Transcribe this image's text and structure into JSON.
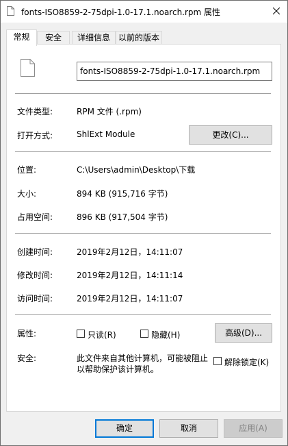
{
  "window": {
    "title": "fonts-ISO8859-2-75dpi-1.0-17.1.noarch.rpm 属性"
  },
  "tabs": [
    {
      "label": "常规",
      "active": true
    },
    {
      "label": "安全",
      "active": false
    },
    {
      "label": "详细信息",
      "active": false
    },
    {
      "label": "以前的版本",
      "active": false
    }
  ],
  "general": {
    "filename": "fonts-ISO8859-2-75dpi-1.0-17.1.noarch.rpm",
    "file_type_label": "文件类型:",
    "file_type_value": "RPM 文件 (.rpm)",
    "opens_with_label": "打开方式:",
    "opens_with_value": "ShlExt Module",
    "change_button": "更改(C)...",
    "location_label": "位置:",
    "location_value": "C:\\Users\\admin\\Desktop\\下载",
    "size_label": "大小:",
    "size_value": "894 KB (915,716 字节)",
    "size_on_disk_label": "占用空间:",
    "size_on_disk_value": "896 KB (917,504 字节)",
    "created_label": "创建时间:",
    "created_value": "2019年2月12日，14:11:07",
    "modified_label": "修改时间:",
    "modified_value": "2019年2月12日，14:11:14",
    "accessed_label": "访问时间:",
    "accessed_value": "2019年2月12日，14:11:07",
    "attributes_label": "属性:",
    "readonly_label": "只读(R)",
    "hidden_label": "隐藏(H)",
    "advanced_button": "高级(D)...",
    "security_label": "安全:",
    "security_text_line1": "此文件来自其他计算机，可能被阻止",
    "security_text_line2": "以帮助保护该计算机。",
    "unblock_label": "解除锁定(K)"
  },
  "footer": {
    "ok": "确定",
    "cancel": "取消",
    "apply": "应用(A)"
  },
  "colors": {
    "accent": "#0078d7",
    "panel_bg": "#ffffff",
    "window_bg": "#f0f0f0"
  },
  "icons": {
    "title": "document-icon",
    "file": "document-icon",
    "close": "close-icon"
  }
}
